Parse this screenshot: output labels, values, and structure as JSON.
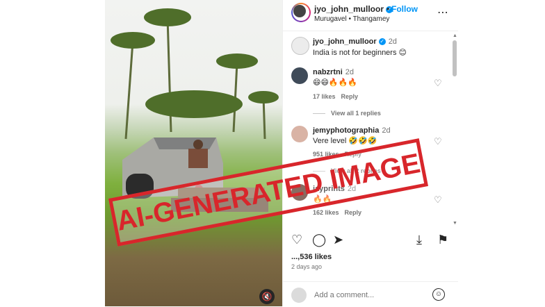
{
  "post": {
    "watermark": "AI-GENERATED IMAGE",
    "mute_icon": "speaker-muted-icon"
  },
  "header": {
    "username": "jyo_john_mulloor",
    "separator": "•",
    "follow_label": "Follow",
    "subtitle": "Murugavel • Thangamey",
    "more_icon": "more-dots-icon"
  },
  "caption": {
    "username": "jyo_john_mulloor",
    "time": "2d",
    "text": "India is not for beginners 😊"
  },
  "comments": [
    {
      "username": "nabzrtni",
      "time": "2d",
      "text": "😄😄🔥🔥🔥",
      "likes": "17 likes",
      "reply": "Reply",
      "view_replies": "View all 1 replies"
    },
    {
      "username": "jemyphotographia",
      "time": "2d",
      "text": "Vere level 🤣🤣🤣",
      "likes": "951 likes",
      "reply": "Reply",
      "view_replies": "View all 2 replies"
    },
    {
      "username": "jayprints",
      "time": "2d",
      "text": "🔥🔥",
      "likes": "162 likes",
      "reply": "Reply"
    }
  ],
  "footer": {
    "likes": "...,536 likes",
    "time_ago": "2 days ago",
    "comment_placeholder": "Add a comment...",
    "icons": [
      "heart-icon",
      "comment-icon",
      "share-icon",
      "save-icon",
      "bookmark-icon",
      "emoji-icon"
    ]
  },
  "colors": {
    "accent": "#0095f6",
    "watermark": "#d8262b"
  }
}
